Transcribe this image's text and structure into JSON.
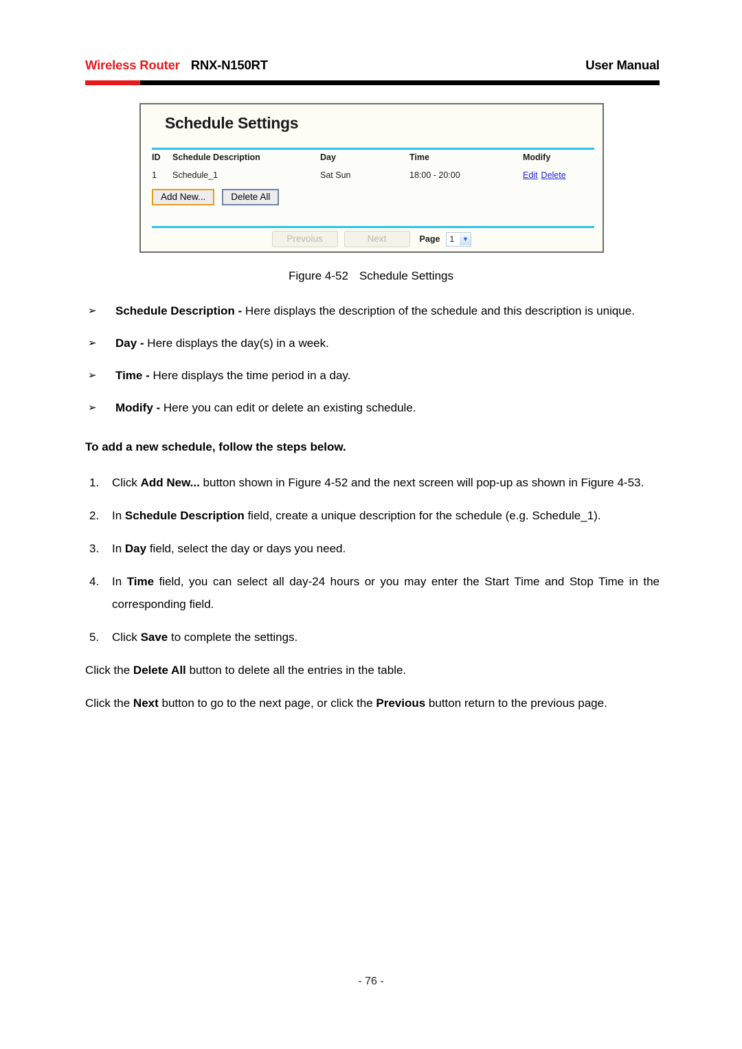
{
  "header": {
    "brand": "Wireless Router",
    "model": "RNX-N150RT",
    "right": "User Manual"
  },
  "figure": {
    "panel_title": "Schedule Settings",
    "table": {
      "columns": [
        "ID",
        "Schedule Description",
        "Day",
        "Time",
        "Modify"
      ],
      "rows": [
        {
          "id": "1",
          "description": "Schedule_1",
          "day": "Sat Sun",
          "time": "18:00 - 20:00",
          "modify_edit": "Edit",
          "modify_delete": "Delete"
        }
      ]
    },
    "buttons": {
      "add_new": "Add New...",
      "delete_all": "Delete All"
    },
    "pager": {
      "previous": "Prevoius",
      "next": "Next",
      "page_label": "Page",
      "page_value": "1"
    },
    "colors": {
      "divider": "#2ec2e8",
      "panel_bg": "#fdfdf5",
      "focus_border": "#e39b21",
      "button_border": "#6e83a8",
      "link": "#2222dd"
    }
  },
  "caption": {
    "figure_number": "Figure 4-52",
    "figure_title": "Schedule Settings"
  },
  "bullets": [
    {
      "marker": "➢",
      "term": "Schedule Description -",
      "text": " Here displays the description of the schedule and this description is unique."
    },
    {
      "marker": "➢",
      "term": "Day -",
      "text": " Here displays the day(s) in a week."
    },
    {
      "marker": "➢",
      "term": "Time -",
      "text": " Here displays the time period in a day."
    },
    {
      "marker": "➢",
      "term": "Modify -",
      "text": " Here you can edit or delete an existing schedule."
    }
  ],
  "lead_text": "To add a new schedule, follow the steps below.",
  "steps": [
    {
      "num": "1.",
      "pre": "Click ",
      "bold": "Add New...",
      "post": " button shown in Figure 4-52 and the next screen will pop-up as shown in Figure 4-53."
    },
    {
      "num": "2.",
      "pre": "In ",
      "bold": "Schedule Description",
      "post": " field, create a unique description for the schedule (e.g. Schedule_1)."
    },
    {
      "num": "3.",
      "pre": "In ",
      "bold": "Day",
      "post": " field, select the day or days you need."
    },
    {
      "num": "4.",
      "pre": "In ",
      "bold": "Time",
      "post": " field, you can select all day-24 hours or you may enter the Start Time and Stop Time in the corresponding field."
    },
    {
      "num": "5.",
      "pre": "Click ",
      "bold": "Save",
      "post": " to complete the settings."
    }
  ],
  "paragraphs": [
    {
      "pre": "Click the ",
      "bold1": "Delete All",
      "mid": " button to delete all the entries in the table.",
      "bold2": "",
      "post": ""
    },
    {
      "pre": "Click the ",
      "bold1": "Next",
      "mid": " button to go to the next page, or click the ",
      "bold2": "Previous",
      "post": " button return to the previous page."
    }
  ],
  "footer": {
    "page_number": "- 76 -"
  }
}
